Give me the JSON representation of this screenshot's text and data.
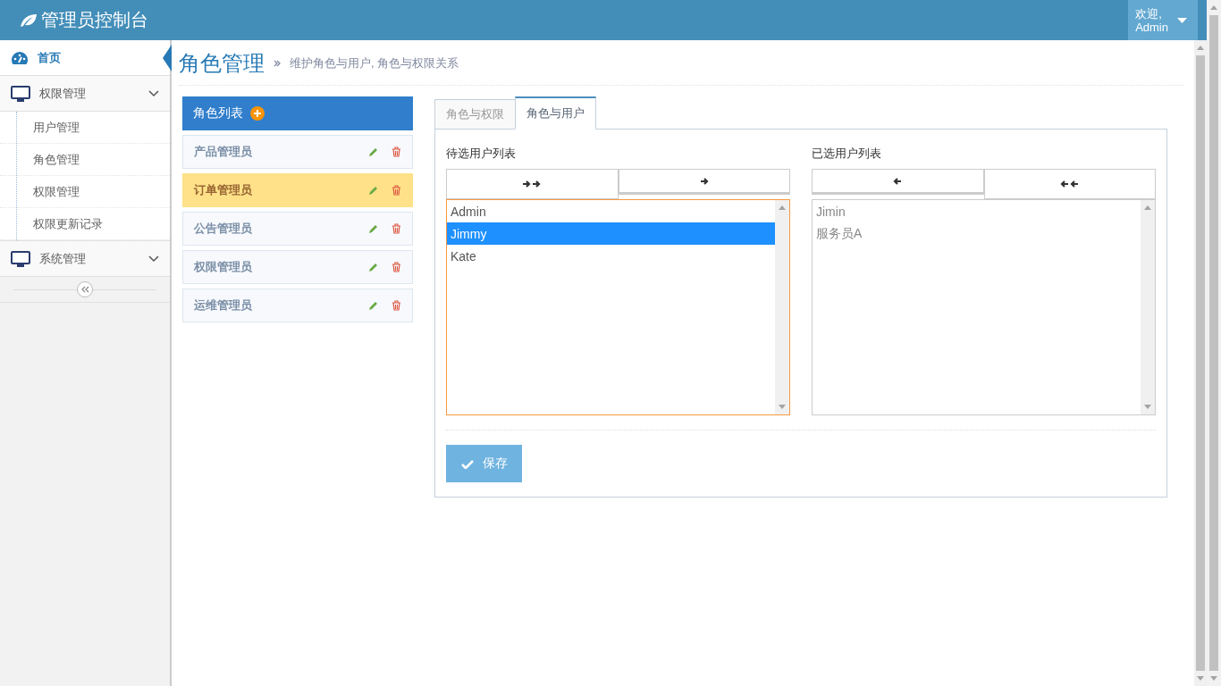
{
  "header": {
    "title": "管理员控制台",
    "greeting": "欢迎,",
    "user_name": "Admin"
  },
  "sidebar": {
    "items": [
      {
        "label": "首页",
        "kind": "link",
        "selected": true
      },
      {
        "label": "权限管理",
        "kind": "group",
        "selected": false,
        "children": [
          {
            "label": "用户管理",
            "selected": false
          },
          {
            "label": "角色管理",
            "selected": false
          },
          {
            "label": "权限管理",
            "selected": false
          },
          {
            "label": "权限更新记录",
            "selected": false
          }
        ]
      },
      {
        "label": "系统管理",
        "kind": "group",
        "selected": false
      }
    ]
  },
  "page": {
    "title": "角色管理",
    "subtitle": "维护角色与用户, 角色与权限关系"
  },
  "role_list": {
    "title": "角色列表",
    "roles": [
      {
        "name": "产品管理员",
        "selected": false
      },
      {
        "name": "订单管理员",
        "selected": true
      },
      {
        "name": "公告管理员",
        "selected": false
      },
      {
        "name": "权限管理员",
        "selected": false
      },
      {
        "name": "运维管理员",
        "selected": false
      }
    ]
  },
  "tabs": [
    {
      "label": "角色与权限",
      "selected": false
    },
    {
      "label": "角色与用户",
      "selected": true
    }
  ],
  "user_lists": [
    {
      "title": "待选用户列表",
      "kind": "available",
      "focused": true,
      "items": [
        {
          "name": "Admin",
          "selected": false
        },
        {
          "name": "Jimmy",
          "selected": true
        },
        {
          "name": "Kate",
          "selected": false
        }
      ]
    },
    {
      "title": "已选用户列表",
      "kind": "chosen",
      "focused": false,
      "items": [
        {
          "name": "Jimin",
          "selected": false
        },
        {
          "name": "服务员A",
          "selected": false
        }
      ]
    }
  ],
  "save_button": "保存"
}
